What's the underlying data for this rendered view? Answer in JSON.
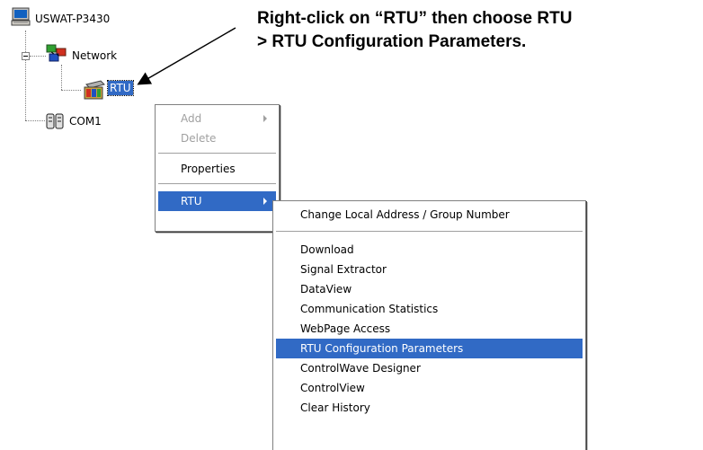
{
  "tree": {
    "root_label": "USWAT-P3430",
    "network_label": "Network",
    "rtu_label": "RTU",
    "com_label": "COM1"
  },
  "callout": {
    "line1": "Right-click on “RTU” then choose RTU",
    "line2": "> RTU Configuration Parameters."
  },
  "context_menu": {
    "add": "Add",
    "delete": "Delete",
    "properties": "Properties",
    "rtu": "RTU"
  },
  "rtu_submenu": {
    "items": [
      "Change Local Address / Group Number",
      "Download",
      "Signal Extractor",
      "DataView",
      "Communication Statistics",
      "WebPage Access",
      "RTU Configuration Parameters",
      "ControlWave Designer",
      "ControlView",
      "Clear History"
    ],
    "highlighted": "RTU Configuration Parameters"
  },
  "colors": {
    "highlight": "#316ac5",
    "disabled_text": "#a0a0a0"
  },
  "icons": [
    "computer-icon",
    "network-icon",
    "rtu-device-icon",
    "com-port-icon",
    "submenu-arrow-icon",
    "callout-arrow"
  ]
}
